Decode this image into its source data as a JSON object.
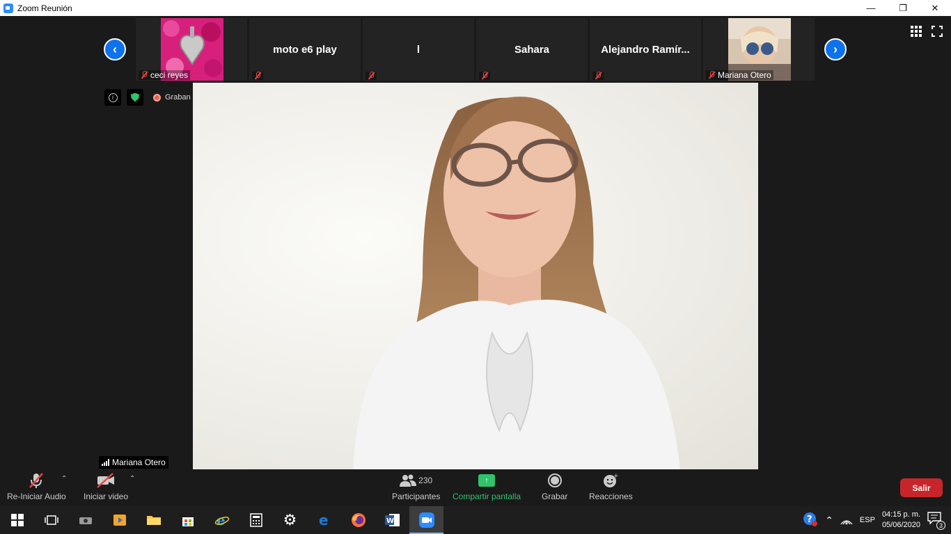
{
  "window": {
    "title": "Zoom Reunión"
  },
  "thumbnails": [
    {
      "name": "ceci reyes",
      "has_video": true
    },
    {
      "name": "moto e6 play",
      "has_video": false
    },
    {
      "name": "l",
      "has_video": false
    },
    {
      "name": "Sahara",
      "has_video": false
    },
    {
      "name": "Alejandro  Ramír...",
      "has_video": false
    },
    {
      "name": "Mariana Otero",
      "has_video": true
    }
  ],
  "status": {
    "recording_label": "Graban"
  },
  "speaker": {
    "name": "Mariana Otero"
  },
  "toolbar": {
    "audio_label": "Re-Iniciar Audio",
    "video_label": "Iniciar video",
    "participants_label": "Participantes",
    "participants_count": "230",
    "share_label": "Compartir pantalla",
    "record_label": "Grabar",
    "reactions_label": "Reacciones",
    "exit_label": "Salir"
  },
  "taskbar": {
    "language": "ESP",
    "time": "04:15 p. m.",
    "date": "05/06/2020",
    "notifications": "3"
  },
  "colors": {
    "accent": "#0e72ed",
    "share_green": "#2fc36c",
    "exit_red": "#c8252b",
    "muted_red": "#e64545"
  }
}
